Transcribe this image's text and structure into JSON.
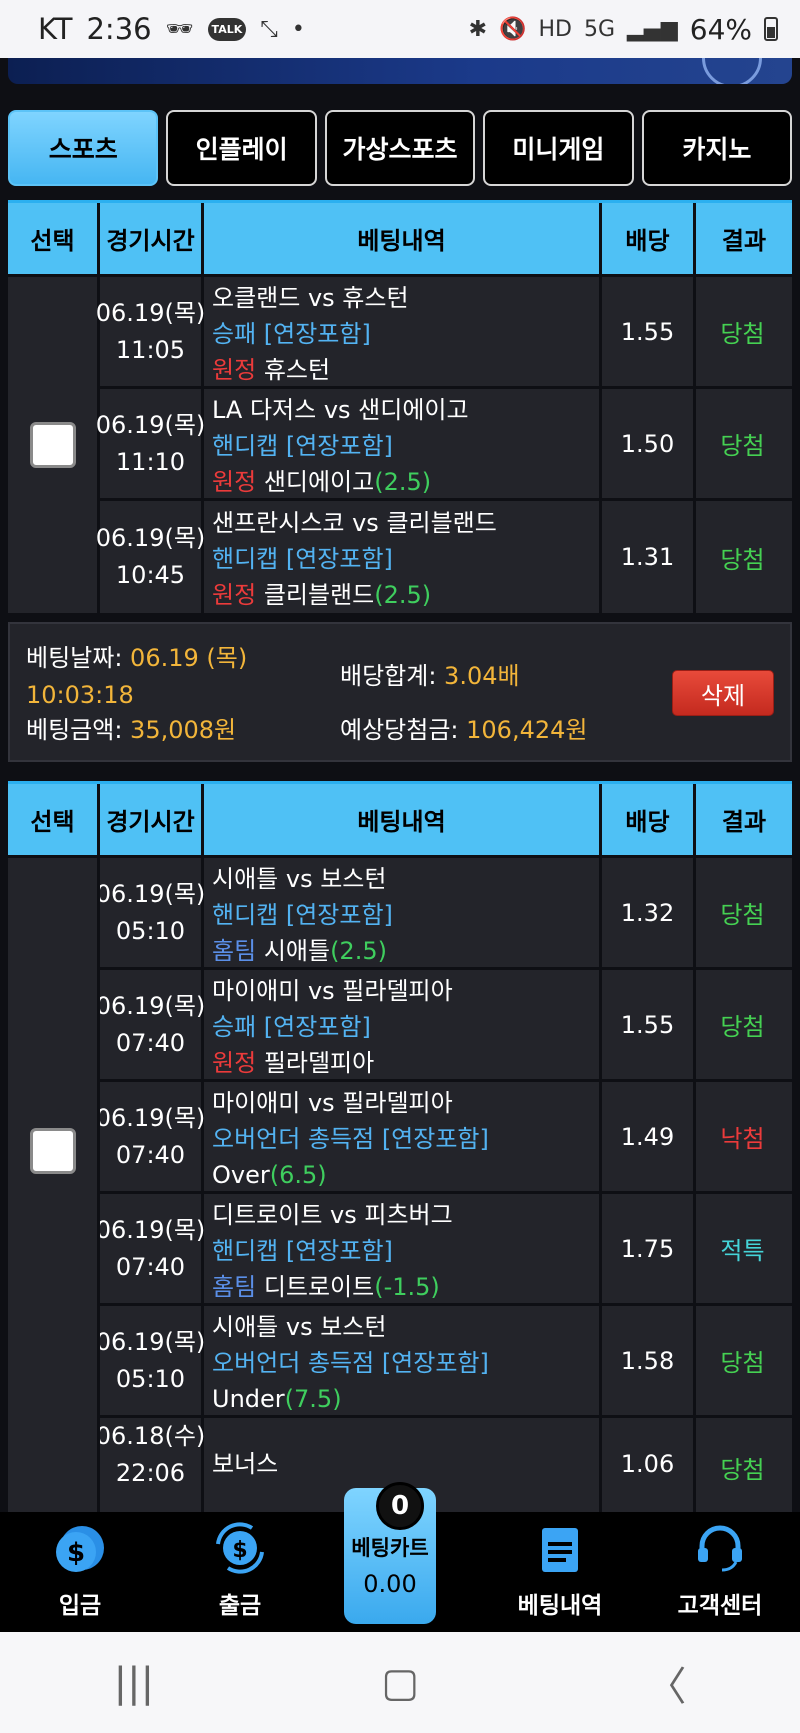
{
  "status_bar": {
    "carrier": "KT",
    "time": "2:36",
    "battery": "64%"
  },
  "tabs": [
    {
      "label": "스포츠",
      "active": true
    },
    {
      "label": "인플레이",
      "active": false
    },
    {
      "label": "가상스포츠",
      "active": false
    },
    {
      "label": "미니게임",
      "active": false
    },
    {
      "label": "카지노",
      "active": false
    }
  ],
  "table_headers": {
    "select": "선택",
    "time": "경기시간",
    "detail": "베팅내역",
    "odds": "배당",
    "result": "결과"
  },
  "bets": [
    {
      "games": [
        {
          "date": "06.19(목)",
          "time": "11:05",
          "match": "오클랜드 vs 휴스턴",
          "market": "승패 [연장포함]",
          "side": "원정",
          "pick": "휴스턴",
          "line": "",
          "odds": "1.55",
          "result": "당첨"
        },
        {
          "date": "06.19(목)",
          "time": "11:10",
          "match": "LA 다저스 vs 샌디에이고",
          "market": "핸디캡 [연장포함]",
          "side": "원정",
          "pick": "샌디에이고",
          "line": "(2.5)",
          "odds": "1.50",
          "result": "당첨"
        },
        {
          "date": "06.19(목)",
          "time": "10:45",
          "match": "샌프란시스코 vs 클리블랜드",
          "market": "핸디캡 [연장포함]",
          "side": "원정",
          "pick": "클리블랜드",
          "line": "(2.5)",
          "odds": "1.31",
          "result": "당첨"
        }
      ],
      "summary": {
        "bet_date_label": "베팅날짜:",
        "bet_date": "06.19 (목)",
        "bet_time": "10:03:18",
        "amount_label": "베팅금액:",
        "amount": "35,008원",
        "total_odds_label": "배당합계:",
        "total_odds": "3.04배",
        "expected_label": "예상당첨금:",
        "expected": "106,424원",
        "delete": "삭제"
      }
    },
    {
      "games": [
        {
          "date": "06.19(목)",
          "time": "05:10",
          "match": "시애틀 vs 보스턴",
          "market": "핸디캡 [연장포함]",
          "side": "홈팀",
          "pick": "시애틀",
          "line": "(2.5)",
          "odds": "1.32",
          "result": "당첨"
        },
        {
          "date": "06.19(목)",
          "time": "07:40",
          "match": "마이애미 vs 필라델피아",
          "market": "승패 [연장포함]",
          "side": "원정",
          "pick": "필라델피아",
          "line": "",
          "odds": "1.55",
          "result": "당첨"
        },
        {
          "date": "06.19(목)",
          "time": "07:40",
          "match": "마이애미 vs 필라델피아",
          "market": "오버언더 총득점 [연장포함]",
          "side": "",
          "pick": "Over",
          "line": "(6.5)",
          "odds": "1.49",
          "result": "낙첨"
        },
        {
          "date": "06.19(목)",
          "time": "07:40",
          "match": "디트로이트 vs 피츠버그",
          "market": "핸디캡 [연장포함]",
          "side": "홈팀",
          "pick": "디트로이트",
          "line": "(-1.5)",
          "odds": "1.75",
          "result": "적특"
        },
        {
          "date": "06.19(목)",
          "time": "05:10",
          "match": "시애틀 vs 보스턴",
          "market": "오버언더 총득점 [연장포함]",
          "side": "",
          "pick": "Under",
          "line": "(7.5)",
          "odds": "1.58",
          "result": "당첨"
        },
        {
          "date": "06.18(수)",
          "time": "22:06",
          "match": "보너스",
          "market": "",
          "side": "",
          "pick": "",
          "line": "",
          "odds": "1.06",
          "result": "당첨"
        }
      ]
    }
  ],
  "bottom_nav": {
    "deposit": "입금",
    "withdraw": "출금",
    "cart_label": "베팅카트",
    "cart_amount": "0.00",
    "cart_count": "0",
    "history": "베팅내역",
    "support": "고객센터"
  },
  "colors": {
    "accent": "#4fc1f5",
    "win": "#45d152",
    "lose": "#ec3b3b",
    "void": "#45d4d8",
    "gold": "#f2b53a"
  }
}
